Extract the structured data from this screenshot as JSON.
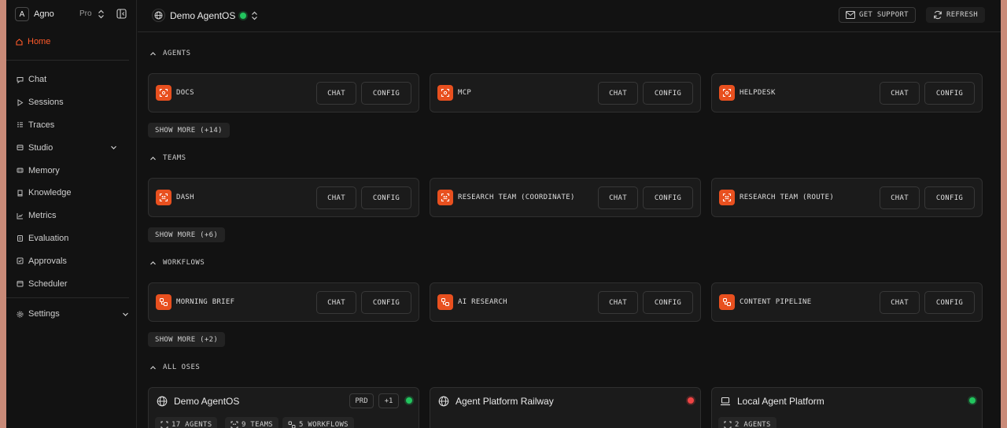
{
  "sidebar": {
    "org_initial": "A",
    "org_name": "Agno",
    "plan": "Pro",
    "home_label": "Home",
    "items": [
      {
        "label": "Chat",
        "icon": "chat-icon"
      },
      {
        "label": "Sessions",
        "icon": "play-icon"
      },
      {
        "label": "Traces",
        "icon": "list-icon"
      },
      {
        "label": "Studio",
        "icon": "studio-icon",
        "expandable": true
      },
      {
        "label": "Memory",
        "icon": "memory-icon"
      },
      {
        "label": "Knowledge",
        "icon": "book-icon"
      },
      {
        "label": "Metrics",
        "icon": "chart-icon"
      },
      {
        "label": "Evaluation",
        "icon": "clipboard-icon"
      },
      {
        "label": "Approvals",
        "icon": "check-square-icon"
      },
      {
        "label": "Scheduler",
        "icon": "calendar-icon"
      }
    ],
    "settings_label": "Settings"
  },
  "header": {
    "os_name": "Demo AgentOS",
    "status_color": "#22c55e",
    "support_label": "GET SUPPORT",
    "refresh_label": "REFRESH"
  },
  "sections": {
    "agents": {
      "title": "AGENTS",
      "cards": [
        {
          "name": "DOCS"
        },
        {
          "name": "MCP"
        },
        {
          "name": "HELPDESK"
        }
      ],
      "show_more": "SHOW MORE (+14)"
    },
    "teams": {
      "title": "TEAMS",
      "cards": [
        {
          "name": "DASH"
        },
        {
          "name": "RESEARCH TEAM (COORDINATE)"
        },
        {
          "name": "RESEARCH TEAM (ROUTE)"
        }
      ],
      "show_more": "SHOW MORE (+6)"
    },
    "workflows": {
      "title": "WORKFLOWS",
      "cards": [
        {
          "name": "MORNING BRIEF"
        },
        {
          "name": "AI RESEARCH"
        },
        {
          "name": "CONTENT PIPELINE"
        }
      ],
      "show_more": "SHOW MORE (+2)"
    },
    "all_oses": {
      "title": "ALL OSES",
      "cards": [
        {
          "name": "Demo AgentOS",
          "icon": "globe-icon",
          "env": "PRD",
          "extra": "+1",
          "status": "green",
          "chips": [
            "17 AGENTS",
            "9 TEAMS",
            "5 WORKFLOWS"
          ]
        },
        {
          "name": "Agent Platform Railway",
          "icon": "globe-icon",
          "status": "red",
          "chips": []
        },
        {
          "name": "Local Agent Platform",
          "icon": "laptop-icon",
          "status": "green",
          "chips": [
            "2 AGENTS"
          ]
        }
      ]
    }
  },
  "card_actions": {
    "chat": "CHAT",
    "config": "CONFIG"
  },
  "colors": {
    "accent": "#e8501f",
    "active_nav": "#ff5a2a",
    "ok": "#22c55e",
    "error": "#ef4444"
  }
}
